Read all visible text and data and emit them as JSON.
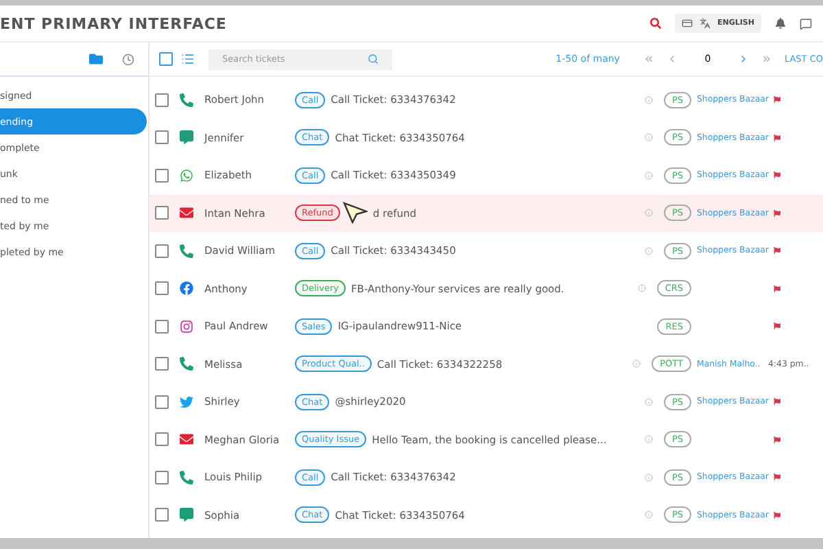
{
  "header": {
    "title": "ENT PRIMARY INTERFACE",
    "language": "ENGLISH"
  },
  "sidebar": {
    "items": [
      {
        "label": "signed",
        "selected": false
      },
      {
        "label": "ending",
        "selected": true
      },
      {
        "label": "omplete",
        "selected": false
      },
      {
        "label": "unk",
        "selected": false
      },
      {
        "label": "ned to me",
        "selected": false
      },
      {
        "label": "ted by me",
        "selected": false
      },
      {
        "label": "pleted by me",
        "selected": false
      }
    ]
  },
  "toolbar": {
    "select_all_checked": false,
    "search_placeholder": "Search tickets",
    "range": "1-50 of many",
    "page": "0",
    "last_column": "LAST CO"
  },
  "rows": [
    {
      "kind": "phone",
      "name": "Robert John",
      "tag": {
        "label": "Call",
        "color": "#3a9ad9"
      },
      "message": "Call Ticket: 6334376342",
      "info": true,
      "team": "PS",
      "agent": "Shoppers Bazaar",
      "flag": true,
      "checked": false,
      "selected": false
    },
    {
      "kind": "chat",
      "name": "Jennifer",
      "tag": {
        "label": "Chat",
        "color": "#3a9ad9"
      },
      "message": "Chat Ticket: 6334350764",
      "info": true,
      "team": "PS",
      "agent": "Shoppers Bazaar",
      "flag": true,
      "checked": false,
      "selected": false
    },
    {
      "kind": "whatsapp",
      "name": "Elizabeth",
      "tag": {
        "label": "Call",
        "color": "#3a9ad9"
      },
      "message": "Call Ticket: 6334350349",
      "info": true,
      "team": "PS",
      "agent": "Shoppers Bazaar",
      "flag": true,
      "checked": false,
      "selected": false
    },
    {
      "kind": "email",
      "name": "Intan Nehra",
      "tag": {
        "label": "Refund",
        "color": "#d9374b"
      },
      "pointer": true,
      "message": "d refund",
      "info": true,
      "team": "PS",
      "agent": "Shoppers Bazaar",
      "flag": true,
      "checked": false,
      "selected": true
    },
    {
      "kind": "phone",
      "name": "David William",
      "tag": {
        "label": "Call",
        "color": "#3a9ad9"
      },
      "message": "Call Ticket: 6334343450",
      "info": true,
      "team": "PS",
      "agent": "Shoppers Bazaar",
      "flag": true,
      "checked": false,
      "selected": false
    },
    {
      "kind": "facebook",
      "name": "Anthony",
      "tag": {
        "label": "Delivery",
        "color": "#3fae5a"
      },
      "message": "FB-Anthony-Your services are really good.",
      "info": true,
      "team": "CRS",
      "flag": true,
      "checked": false,
      "selected": false
    },
    {
      "kind": "instagram",
      "name": "Paul Andrew",
      "tag": {
        "label": "Sales",
        "color": "#3a9ad9"
      },
      "message": "IG-ipaulandrew911-Nice",
      "info": false,
      "team": "RES",
      "flag": true,
      "checked": false,
      "selected": false
    },
    {
      "kind": "phone",
      "name": "Melissa",
      "tag": {
        "label": "Product Qual..",
        "color": "#3a9ad9"
      },
      "message": "Call Ticket: 6334322258",
      "info": true,
      "team": "POTT",
      "agent": "Manish Malho..",
      "time": "4:43 pm..",
      "flag": false,
      "checked": false,
      "selected": false
    },
    {
      "kind": "twitter",
      "name": "Shirley",
      "tag": {
        "label": "Chat",
        "color": "#3a9ad9"
      },
      "message": "@shirley2020",
      "info": true,
      "team": "PS",
      "agent": "Shoppers Bazaar",
      "flag": true,
      "checked": false,
      "selected": false
    },
    {
      "kind": "email",
      "name": "Meghan Gloria",
      "tag": {
        "label": "Quality Issue",
        "color": "#3a9ad9"
      },
      "message": "Hello Team, the booking is cancelled please...",
      "info": true,
      "team": "PS",
      "flag": true,
      "checked": false,
      "selected": false
    },
    {
      "kind": "phone",
      "name": "Louis Philip",
      "tag": {
        "label": "Call",
        "color": "#3a9ad9"
      },
      "message": "Call Ticket: 6334376342",
      "info": true,
      "team": "PS",
      "agent": "Shoppers Bazaar",
      "flag": true,
      "checked": false,
      "selected": false
    },
    {
      "kind": "chat",
      "name": "Sophia",
      "tag": {
        "label": "Chat",
        "color": "#3a9ad9"
      },
      "message": "Chat Ticket: 6334350764",
      "info": true,
      "team": "PS",
      "agent": "Shoppers Bazaar",
      "flag": true,
      "checked": false,
      "selected": false
    }
  ]
}
